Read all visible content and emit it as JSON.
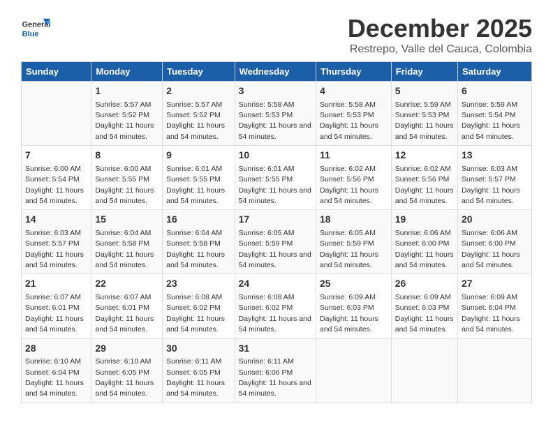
{
  "header": {
    "logo_general": "General",
    "logo_blue": "Blue",
    "main_title": "December 2025",
    "sub_title": "Restrepo, Valle del Cauca, Colombia"
  },
  "days_of_week": [
    "Sunday",
    "Monday",
    "Tuesday",
    "Wednesday",
    "Thursday",
    "Friday",
    "Saturday"
  ],
  "weeks": [
    [
      {
        "day": "",
        "sunrise": "",
        "sunset": "",
        "daylight": ""
      },
      {
        "day": "1",
        "sunrise": "Sunrise: 5:57 AM",
        "sunset": "Sunset: 5:52 PM",
        "daylight": "Daylight: 11 hours and 54 minutes."
      },
      {
        "day": "2",
        "sunrise": "Sunrise: 5:57 AM",
        "sunset": "Sunset: 5:52 PM",
        "daylight": "Daylight: 11 hours and 54 minutes."
      },
      {
        "day": "3",
        "sunrise": "Sunrise: 5:58 AM",
        "sunset": "Sunset: 5:53 PM",
        "daylight": "Daylight: 11 hours and 54 minutes."
      },
      {
        "day": "4",
        "sunrise": "Sunrise: 5:58 AM",
        "sunset": "Sunset: 5:53 PM",
        "daylight": "Daylight: 11 hours and 54 minutes."
      },
      {
        "day": "5",
        "sunrise": "Sunrise: 5:59 AM",
        "sunset": "Sunset: 5:53 PM",
        "daylight": "Daylight: 11 hours and 54 minutes."
      },
      {
        "day": "6",
        "sunrise": "Sunrise: 5:59 AM",
        "sunset": "Sunset: 5:54 PM",
        "daylight": "Daylight: 11 hours and 54 minutes."
      }
    ],
    [
      {
        "day": "7",
        "sunrise": "Sunrise: 6:00 AM",
        "sunset": "Sunset: 5:54 PM",
        "daylight": "Daylight: 11 hours and 54 minutes."
      },
      {
        "day": "8",
        "sunrise": "Sunrise: 6:00 AM",
        "sunset": "Sunset: 5:55 PM",
        "daylight": "Daylight: 11 hours and 54 minutes."
      },
      {
        "day": "9",
        "sunrise": "Sunrise: 6:01 AM",
        "sunset": "Sunset: 5:55 PM",
        "daylight": "Daylight: 11 hours and 54 minutes."
      },
      {
        "day": "10",
        "sunrise": "Sunrise: 6:01 AM",
        "sunset": "Sunset: 5:55 PM",
        "daylight": "Daylight: 11 hours and 54 minutes."
      },
      {
        "day": "11",
        "sunrise": "Sunrise: 6:02 AM",
        "sunset": "Sunset: 5:56 PM",
        "daylight": "Daylight: 11 hours and 54 minutes."
      },
      {
        "day": "12",
        "sunrise": "Sunrise: 6:02 AM",
        "sunset": "Sunset: 5:56 PM",
        "daylight": "Daylight: 11 hours and 54 minutes."
      },
      {
        "day": "13",
        "sunrise": "Sunrise: 6:03 AM",
        "sunset": "Sunset: 5:57 PM",
        "daylight": "Daylight: 11 hours and 54 minutes."
      }
    ],
    [
      {
        "day": "14",
        "sunrise": "Sunrise: 6:03 AM",
        "sunset": "Sunset: 5:57 PM",
        "daylight": "Daylight: 11 hours and 54 minutes."
      },
      {
        "day": "15",
        "sunrise": "Sunrise: 6:04 AM",
        "sunset": "Sunset: 5:58 PM",
        "daylight": "Daylight: 11 hours and 54 minutes."
      },
      {
        "day": "16",
        "sunrise": "Sunrise: 6:04 AM",
        "sunset": "Sunset: 5:58 PM",
        "daylight": "Daylight: 11 hours and 54 minutes."
      },
      {
        "day": "17",
        "sunrise": "Sunrise: 6:05 AM",
        "sunset": "Sunset: 5:59 PM",
        "daylight": "Daylight: 11 hours and 54 minutes."
      },
      {
        "day": "18",
        "sunrise": "Sunrise: 6:05 AM",
        "sunset": "Sunset: 5:59 PM",
        "daylight": "Daylight: 11 hours and 54 minutes."
      },
      {
        "day": "19",
        "sunrise": "Sunrise: 6:06 AM",
        "sunset": "Sunset: 6:00 PM",
        "daylight": "Daylight: 11 hours and 54 minutes."
      },
      {
        "day": "20",
        "sunrise": "Sunrise: 6:06 AM",
        "sunset": "Sunset: 6:00 PM",
        "daylight": "Daylight: 11 hours and 54 minutes."
      }
    ],
    [
      {
        "day": "21",
        "sunrise": "Sunrise: 6:07 AM",
        "sunset": "Sunset: 6:01 PM",
        "daylight": "Daylight: 11 hours and 54 minutes."
      },
      {
        "day": "22",
        "sunrise": "Sunrise: 6:07 AM",
        "sunset": "Sunset: 6:01 PM",
        "daylight": "Daylight: 11 hours and 54 minutes."
      },
      {
        "day": "23",
        "sunrise": "Sunrise: 6:08 AM",
        "sunset": "Sunset: 6:02 PM",
        "daylight": "Daylight: 11 hours and 54 minutes."
      },
      {
        "day": "24",
        "sunrise": "Sunrise: 6:08 AM",
        "sunset": "Sunset: 6:02 PM",
        "daylight": "Daylight: 11 hours and 54 minutes."
      },
      {
        "day": "25",
        "sunrise": "Sunrise: 6:09 AM",
        "sunset": "Sunset: 6:03 PM",
        "daylight": "Daylight: 11 hours and 54 minutes."
      },
      {
        "day": "26",
        "sunrise": "Sunrise: 6:09 AM",
        "sunset": "Sunset: 6:03 PM",
        "daylight": "Daylight: 11 hours and 54 minutes."
      },
      {
        "day": "27",
        "sunrise": "Sunrise: 6:09 AM",
        "sunset": "Sunset: 6:04 PM",
        "daylight": "Daylight: 11 hours and 54 minutes."
      }
    ],
    [
      {
        "day": "28",
        "sunrise": "Sunrise: 6:10 AM",
        "sunset": "Sunset: 6:04 PM",
        "daylight": "Daylight: 11 hours and 54 minutes."
      },
      {
        "day": "29",
        "sunrise": "Sunrise: 6:10 AM",
        "sunset": "Sunset: 6:05 PM",
        "daylight": "Daylight: 11 hours and 54 minutes."
      },
      {
        "day": "30",
        "sunrise": "Sunrise: 6:11 AM",
        "sunset": "Sunset: 6:05 PM",
        "daylight": "Daylight: 11 hours and 54 minutes."
      },
      {
        "day": "31",
        "sunrise": "Sunrise: 6:11 AM",
        "sunset": "Sunset: 6:06 PM",
        "daylight": "Daylight: 11 hours and 54 minutes."
      },
      {
        "day": "",
        "sunrise": "",
        "sunset": "",
        "daylight": ""
      },
      {
        "day": "",
        "sunrise": "",
        "sunset": "",
        "daylight": ""
      },
      {
        "day": "",
        "sunrise": "",
        "sunset": "",
        "daylight": ""
      }
    ]
  ]
}
